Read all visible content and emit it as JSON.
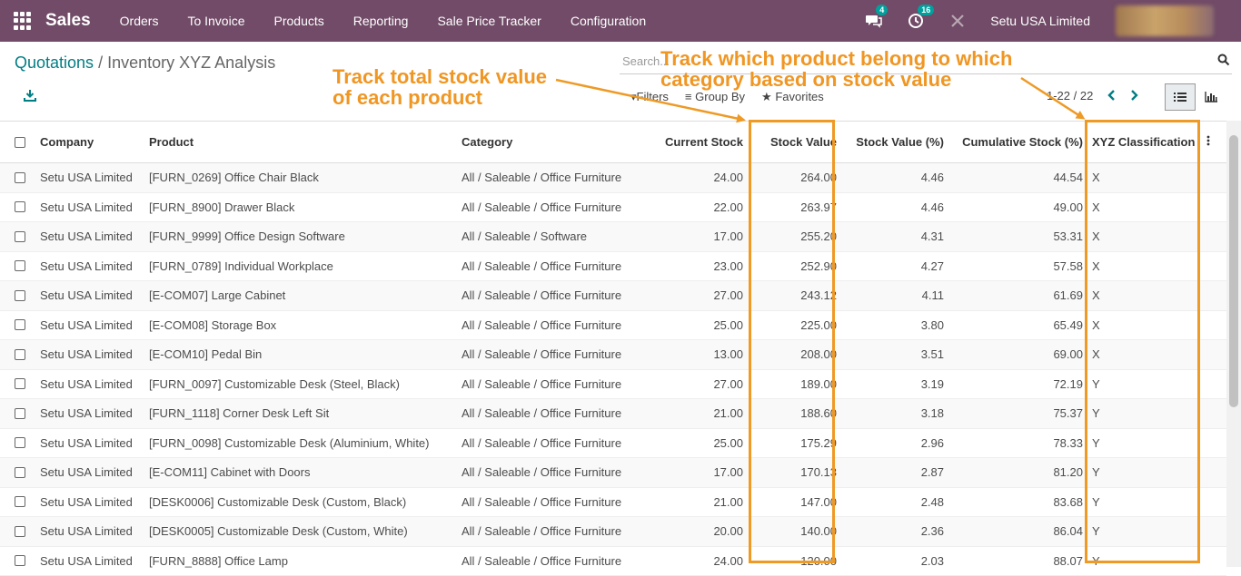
{
  "app": {
    "name": "Sales"
  },
  "nav": {
    "menus": [
      "Orders",
      "To Invoice",
      "Products",
      "Reporting",
      "Sale Price Tracker",
      "Configuration"
    ],
    "messages_badge": "4",
    "activities_badge": "16",
    "company": "Setu USA Limited"
  },
  "breadcrumb": {
    "parent": "Quotations",
    "separator": "/",
    "current": "Inventory XYZ Analysis"
  },
  "search": {
    "placeholder": "Search..."
  },
  "filters": {
    "filters_label": "Filters",
    "groupby_label": "Group By",
    "favorites_label": "Favorites"
  },
  "pager": {
    "range": "1-22 / 22"
  },
  "table": {
    "headers": {
      "company": "Company",
      "product": "Product",
      "category": "Category",
      "current_stock": "Current Stock",
      "stock_value": "Stock Value",
      "stock_value_pct": "Stock Value (%)",
      "cumulative_stock": "Cumulative Stock (%)",
      "xyz": "XYZ Classification"
    },
    "rows": [
      [
        "Setu USA Limited",
        "[FURN_0269] Office Chair Black",
        "All / Saleable / Office Furniture",
        "24.00",
        "264.00",
        "4.46",
        "44.54",
        "X"
      ],
      [
        "Setu USA Limited",
        "[FURN_8900] Drawer Black",
        "All / Saleable / Office Furniture",
        "22.00",
        "263.97",
        "4.46",
        "49.00",
        "X"
      ],
      [
        "Setu USA Limited",
        "[FURN_9999] Office Design Software",
        "All / Saleable / Software",
        "17.00",
        "255.20",
        "4.31",
        "53.31",
        "X"
      ],
      [
        "Setu USA Limited",
        "[FURN_0789] Individual Workplace",
        "All / Saleable / Office Furniture",
        "23.00",
        "252.90",
        "4.27",
        "57.58",
        "X"
      ],
      [
        "Setu USA Limited",
        "[E-COM07] Large Cabinet",
        "All / Saleable / Office Furniture",
        "27.00",
        "243.12",
        "4.11",
        "61.69",
        "X"
      ],
      [
        "Setu USA Limited",
        "[E-COM08] Storage Box",
        "All / Saleable / Office Furniture",
        "25.00",
        "225.00",
        "3.80",
        "65.49",
        "X"
      ],
      [
        "Setu USA Limited",
        "[E-COM10] Pedal Bin",
        "All / Saleable / Office Furniture",
        "13.00",
        "208.00",
        "3.51",
        "69.00",
        "X"
      ],
      [
        "Setu USA Limited",
        "[FURN_0097] Customizable Desk (Steel, Black)",
        "All / Saleable / Office Furniture",
        "27.00",
        "189.00",
        "3.19",
        "72.19",
        "Y"
      ],
      [
        "Setu USA Limited",
        "[FURN_1118] Corner Desk Left Sit",
        "All / Saleable / Office Furniture",
        "21.00",
        "188.60",
        "3.18",
        "75.37",
        "Y"
      ],
      [
        "Setu USA Limited",
        "[FURN_0098] Customizable Desk (Aluminium, White)",
        "All / Saleable / Office Furniture",
        "25.00",
        "175.29",
        "2.96",
        "78.33",
        "Y"
      ],
      [
        "Setu USA Limited",
        "[E-COM11] Cabinet with Doors",
        "All / Saleable / Office Furniture",
        "17.00",
        "170.13",
        "2.87",
        "81.20",
        "Y"
      ],
      [
        "Setu USA Limited",
        "[DESK0006] Customizable Desk (Custom, Black)",
        "All / Saleable / Office Furniture",
        "21.00",
        "147.00",
        "2.48",
        "83.68",
        "Y"
      ],
      [
        "Setu USA Limited",
        "[DESK0005] Customizable Desk (Custom, White)",
        "All / Saleable / Office Furniture",
        "20.00",
        "140.00",
        "2.36",
        "86.04",
        "Y"
      ],
      [
        "Setu USA Limited",
        "[FURN_8888] Office Lamp",
        "All / Saleable / Office Furniture",
        "24.00",
        "120.00",
        "2.03",
        "88.07",
        "Y"
      ]
    ]
  },
  "annotations": {
    "stock_value": [
      "Track total stock value",
      "of each product"
    ],
    "xyz": [
      "Track which product belong to which",
      "category based on stock value"
    ],
    "color": "#ee9a25"
  },
  "colors": {
    "navbar": "#714b67",
    "link": "#017e84",
    "badge": "#00a09d"
  }
}
